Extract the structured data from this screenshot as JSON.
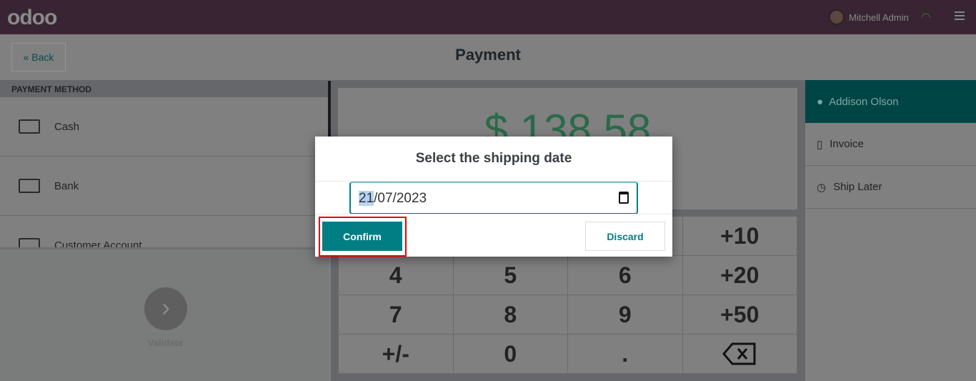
{
  "header": {
    "logo": "odoo",
    "user": "Mitchell Admin",
    "wifi_color": "#3d7a1a"
  },
  "topbar": {
    "back": "« Back",
    "title": "Payment"
  },
  "payment_methods": {
    "heading": "PAYMENT METHOD",
    "items": [
      {
        "label": "Cash",
        "icon": "money-icon"
      },
      {
        "label": "Bank",
        "icon": "bank-card-icon"
      },
      {
        "label": "Customer Account",
        "icon": "wallet-icon"
      }
    ]
  },
  "validate": {
    "label": "Validate"
  },
  "amount": "$ 138.58",
  "numpad": [
    "",
    "",
    "",
    "+10",
    "4",
    "5",
    "6",
    "+20",
    "7",
    "8",
    "9",
    "+50",
    "+/-",
    "0",
    "."
  ],
  "right": {
    "customer": "Addison Olson",
    "invoice": "Invoice",
    "ship_later": "Ship Later"
  },
  "modal": {
    "title": "Select the shipping date",
    "date_day": "21",
    "date_rest": "/07/2023",
    "confirm": "Confirm",
    "discard": "Discard",
    "accent": "#017e84"
  }
}
